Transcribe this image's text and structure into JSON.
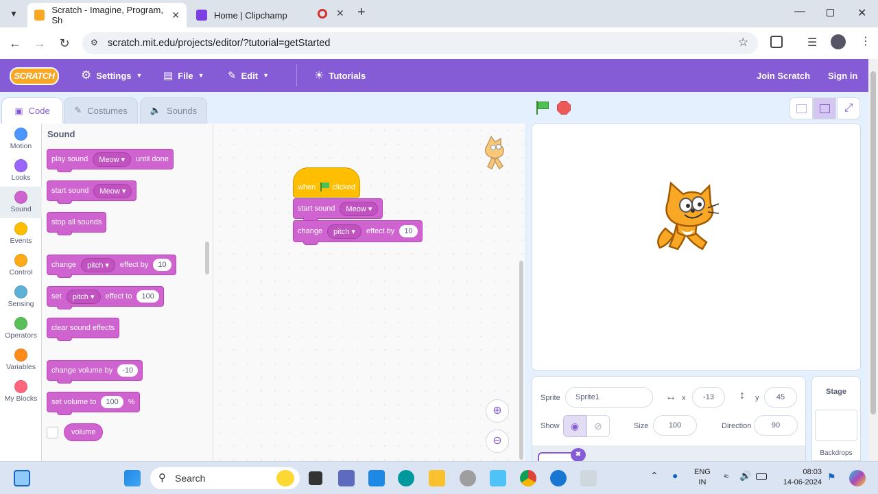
{
  "browser": {
    "tabs": [
      {
        "title": "Scratch - Imagine, Program, Sh",
        "active": true
      },
      {
        "title": "Home | Clipchamp",
        "active": false
      }
    ],
    "url": "scratch.mit.edu/projects/editor/?tutorial=getStarted"
  },
  "menu": {
    "logo": "SCRATCH",
    "settings": "Settings",
    "file": "File",
    "edit": "Edit",
    "tutorials": "Tutorials",
    "join": "Join Scratch",
    "signin": "Sign in"
  },
  "editor_tabs": {
    "code": "Code",
    "costumes": "Costumes",
    "sounds": "Sounds"
  },
  "categories": [
    {
      "label": "Motion",
      "color": "#4c97ff"
    },
    {
      "label": "Looks",
      "color": "#9966ff"
    },
    {
      "label": "Sound",
      "color": "#cf63cf"
    },
    {
      "label": "Events",
      "color": "#ffbf00"
    },
    {
      "label": "Control",
      "color": "#ffab19"
    },
    {
      "label": "Sensing",
      "color": "#5cb1d6"
    },
    {
      "label": "Operators",
      "color": "#59c059"
    },
    {
      "label": "Variables",
      "color": "#ff8c1a"
    },
    {
      "label": "My Blocks",
      "color": "#ff6680"
    }
  ],
  "palette": {
    "heading": "Sound",
    "play_sound": {
      "pre": "play sound",
      "menu": "Meow",
      "post": "until done"
    },
    "start_sound": {
      "pre": "start sound",
      "menu": "Meow"
    },
    "stop_all": "stop all sounds",
    "change_effect": {
      "pre": "change",
      "menu": "pitch",
      "mid": "effect by",
      "value": "10"
    },
    "set_effect": {
      "pre": "set",
      "menu": "pitch",
      "mid": "effect to",
      "value": "100"
    },
    "clear_effects": "clear sound effects",
    "change_volume": {
      "pre": "change volume by",
      "value": "-10"
    },
    "set_volume": {
      "pre": "set volume to",
      "value": "100",
      "post": "%"
    },
    "volume_reporter": "volume"
  },
  "script": {
    "hat": {
      "pre": "when",
      "post": "clicked"
    },
    "start_sound": {
      "pre": "start sound",
      "menu": "Meow"
    },
    "change_effect": {
      "pre": "change",
      "menu": "pitch",
      "mid": "effect by",
      "value": "10"
    }
  },
  "sprite_info": {
    "sprite_label": "Sprite",
    "sprite_name": "Sprite1",
    "x_label": "x",
    "x": "-13",
    "y_label": "y",
    "y": "45",
    "show_label": "Show",
    "size_label": "Size",
    "size": "100",
    "direction_label": "Direction",
    "direction": "90"
  },
  "stage_pane": {
    "title": "Stage",
    "backdrops": "Backdrops"
  },
  "taskbar": {
    "search": "Search",
    "lang1": "ENG",
    "lang2": "IN",
    "time": "08:03",
    "date": "14-06-2024"
  },
  "colors": {
    "scratch_purple": "#855cd6",
    "sound_block": "#cf63cf",
    "events_yellow": "#ffbf00"
  }
}
